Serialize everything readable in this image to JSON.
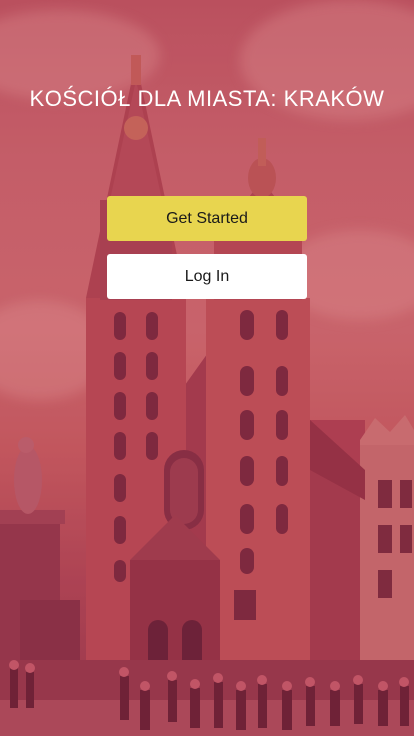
{
  "app": {
    "title": "KOŚCIÓŁ DLA MIASTA: KRAKÓW"
  },
  "actions": {
    "get_started_label": "Get Started",
    "log_in_label": "Log In"
  },
  "colors": {
    "primary_button": "#e8d54f",
    "secondary_button": "#ffffff",
    "overlay_tint": "#c8285a",
    "title_text": "#ffffff"
  },
  "background": {
    "image": "church-photo"
  }
}
